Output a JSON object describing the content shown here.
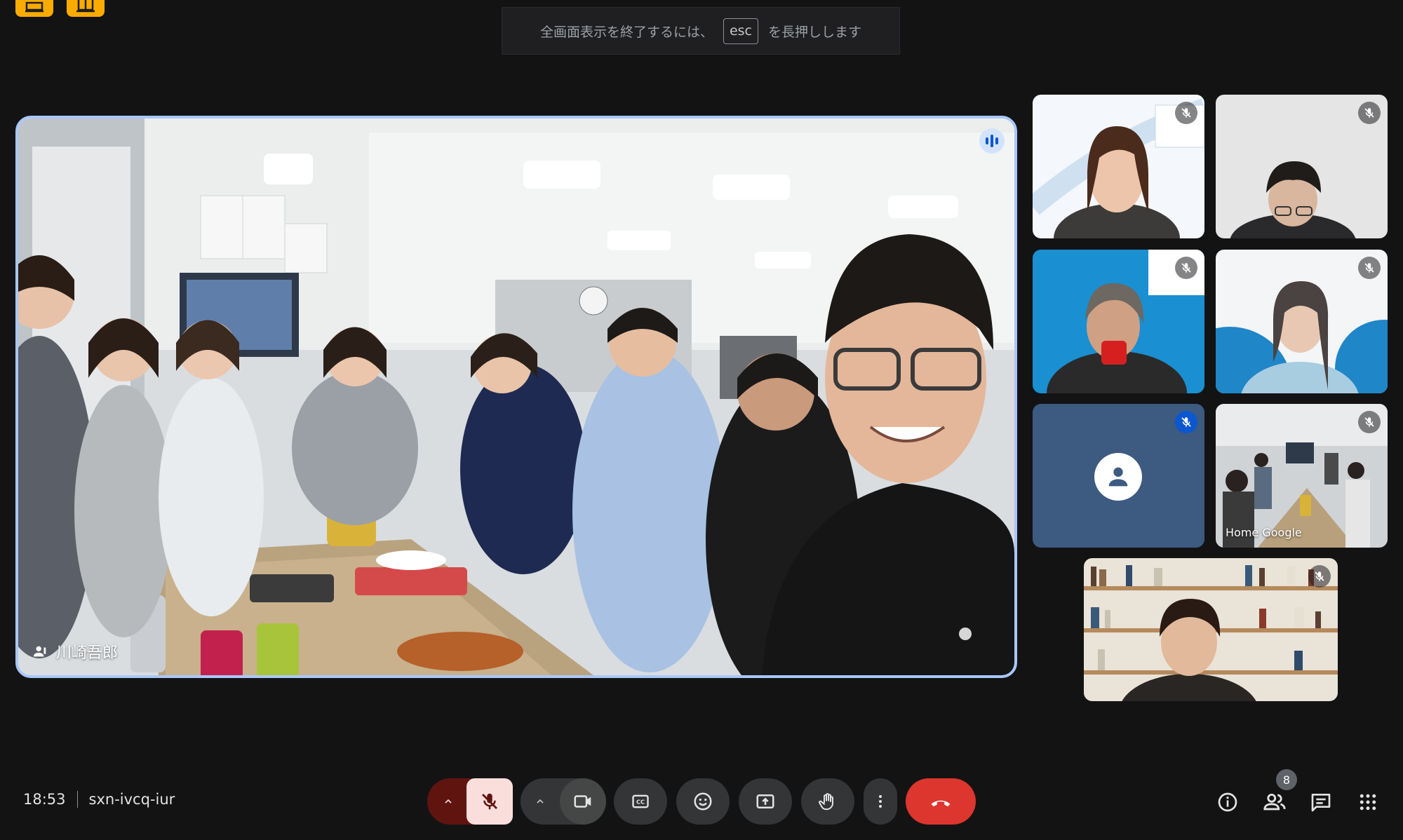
{
  "banner": {
    "before": "全画面表示を終了するには、",
    "key": "esc",
    "after": "を長押しします"
  },
  "main_tile": {
    "participant_name": "川崎吾郎",
    "speaking_icon": "audio-level-icon"
  },
  "tiles": [
    {
      "id": "participant-1",
      "muted": true,
      "name": ""
    },
    {
      "id": "participant-2",
      "muted": true,
      "name": ""
    },
    {
      "id": "participant-3",
      "muted": true,
      "name": ""
    },
    {
      "id": "participant-4",
      "muted": true,
      "name": ""
    },
    {
      "id": "participant-5",
      "muted": true,
      "name": "",
      "avatar": "person-icon"
    },
    {
      "id": "participant-6",
      "muted": true,
      "name": "Home Google"
    },
    {
      "id": "participant-7",
      "muted": true,
      "name": ""
    }
  ],
  "meeting": {
    "time": "18:53",
    "code": "sxn-ivcq-iur"
  },
  "controls": {
    "mic": "mic-off-icon",
    "camera": "videocam-icon",
    "captions": "closed-caption-icon",
    "emoji": "emoji-icon",
    "present": "present-screen-icon",
    "raise_hand": "raise-hand-icon",
    "more": "more-vert-icon",
    "leave": "call-end-icon"
  },
  "right_controls": {
    "participants_count": "8"
  },
  "colors": {
    "background": "#131314",
    "active_border": "#a8c7fa",
    "leave": "#dc362e",
    "mic_off_bg": "#f9dedc",
    "mic_menu_bg": "#601410",
    "mute_badge_blue": "#0b57d0"
  }
}
